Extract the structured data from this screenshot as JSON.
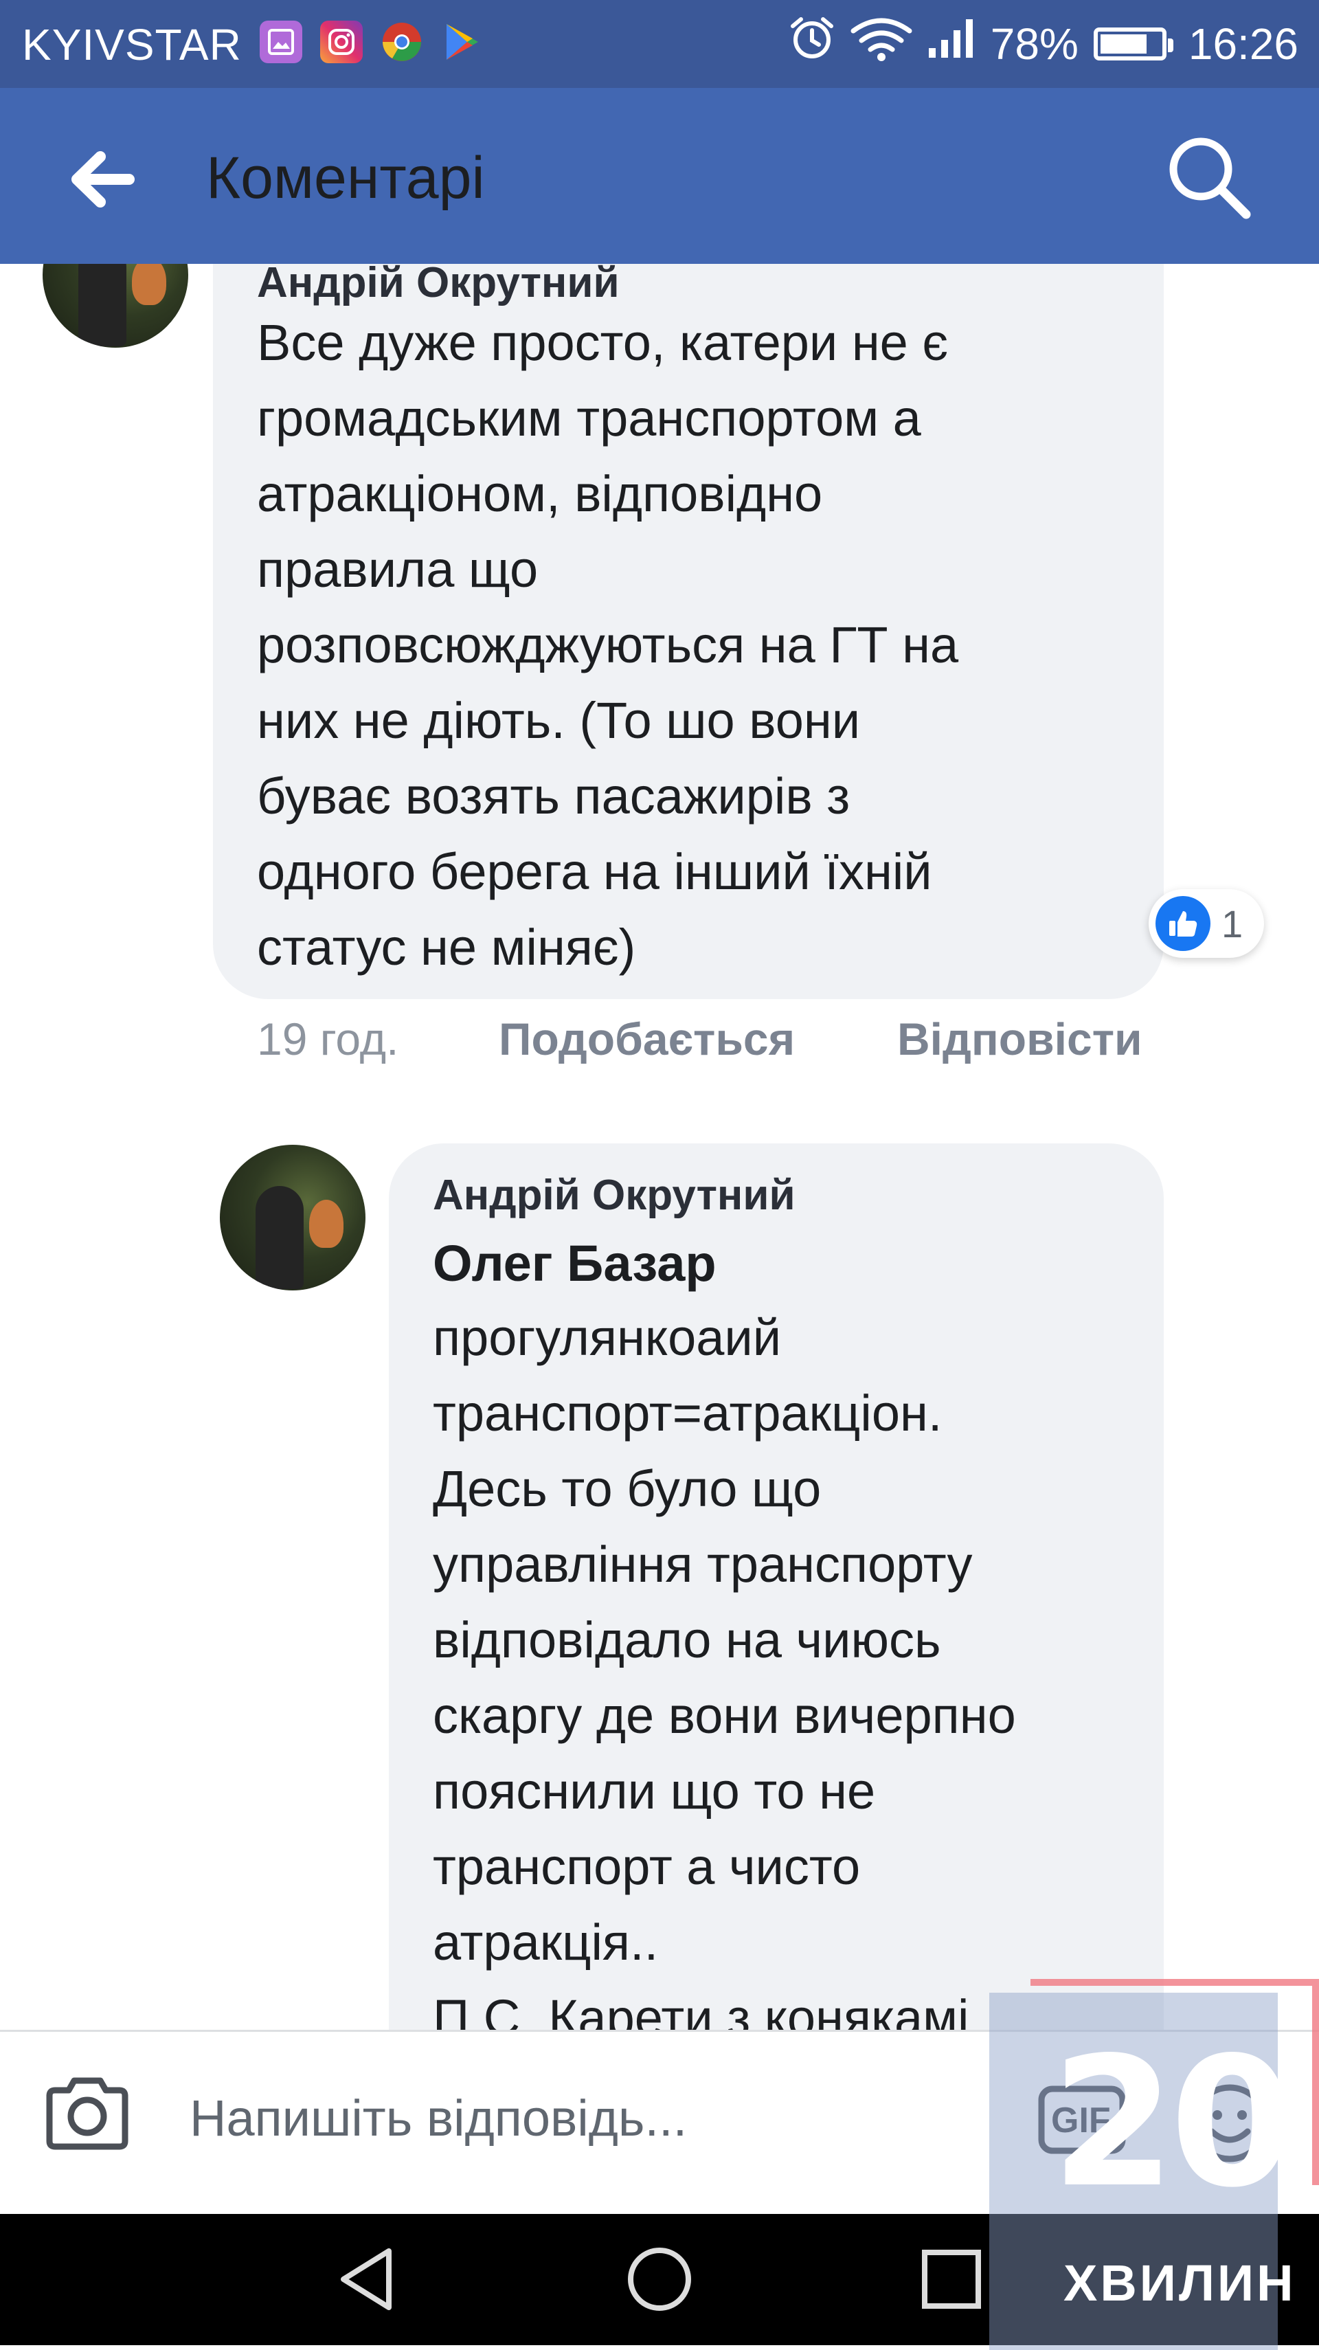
{
  "status_bar": {
    "carrier": "KYIVSTAR",
    "battery_percent": "78%",
    "battery_level": 0.78,
    "time": "16:26",
    "app_icons": [
      "gallery-icon",
      "instagram-icon",
      "chrome-icon",
      "play-store-icon"
    ],
    "status_icons": [
      "alarm-icon",
      "wifi-icon",
      "signal-icon",
      "battery-icon"
    ]
  },
  "app_bar": {
    "title": "Коментарі",
    "back_icon": "arrow-left-icon",
    "search_icon": "search-icon"
  },
  "comments": [
    {
      "author": "Андрій Окрутний",
      "text": "Все дуже просто, катери не є\nгромадським транспортом а\nатракціоном, відповідно\nправила що\nрозповсюжджуються на ГТ на\nних не діють. (То шо вони\nбуває возять пасажирів з\nодного берега на інший їхній\nстатус не міняє)",
      "reaction_count": "1",
      "time": "19 год.",
      "like_label": "Подобається",
      "reply_label": "Відповісти"
    },
    {
      "author": "Андрій Окрутний",
      "mention": "Олег Базар",
      "text": "прогулянкоаий\nтранспорт=атракціон.\nДесь то було що\nуправління транспорту\nвідповідало на чиюсь\nскаргу де вони вичерпно\nпояснили що то не\nтранспорт а чисто\nатракція..\nП.С. Карети з конякамі"
    }
  ],
  "reply_bar": {
    "placeholder": "Напишіть відповідь...",
    "camera_icon": "camera-icon",
    "gif_label": "GIF",
    "emoji_icon": "emoji-icon"
  },
  "nav_bar": {
    "buttons": [
      "back-triangle-icon",
      "home-circle-icon",
      "recents-square-icon"
    ]
  },
  "watermark": {
    "number": "20",
    "word": "ХВИЛИН"
  },
  "colors": {
    "status_bar": "#3b5898",
    "app_bar": "#4267b2",
    "bubble": "#f0f2f5",
    "like": "#1877f2"
  }
}
